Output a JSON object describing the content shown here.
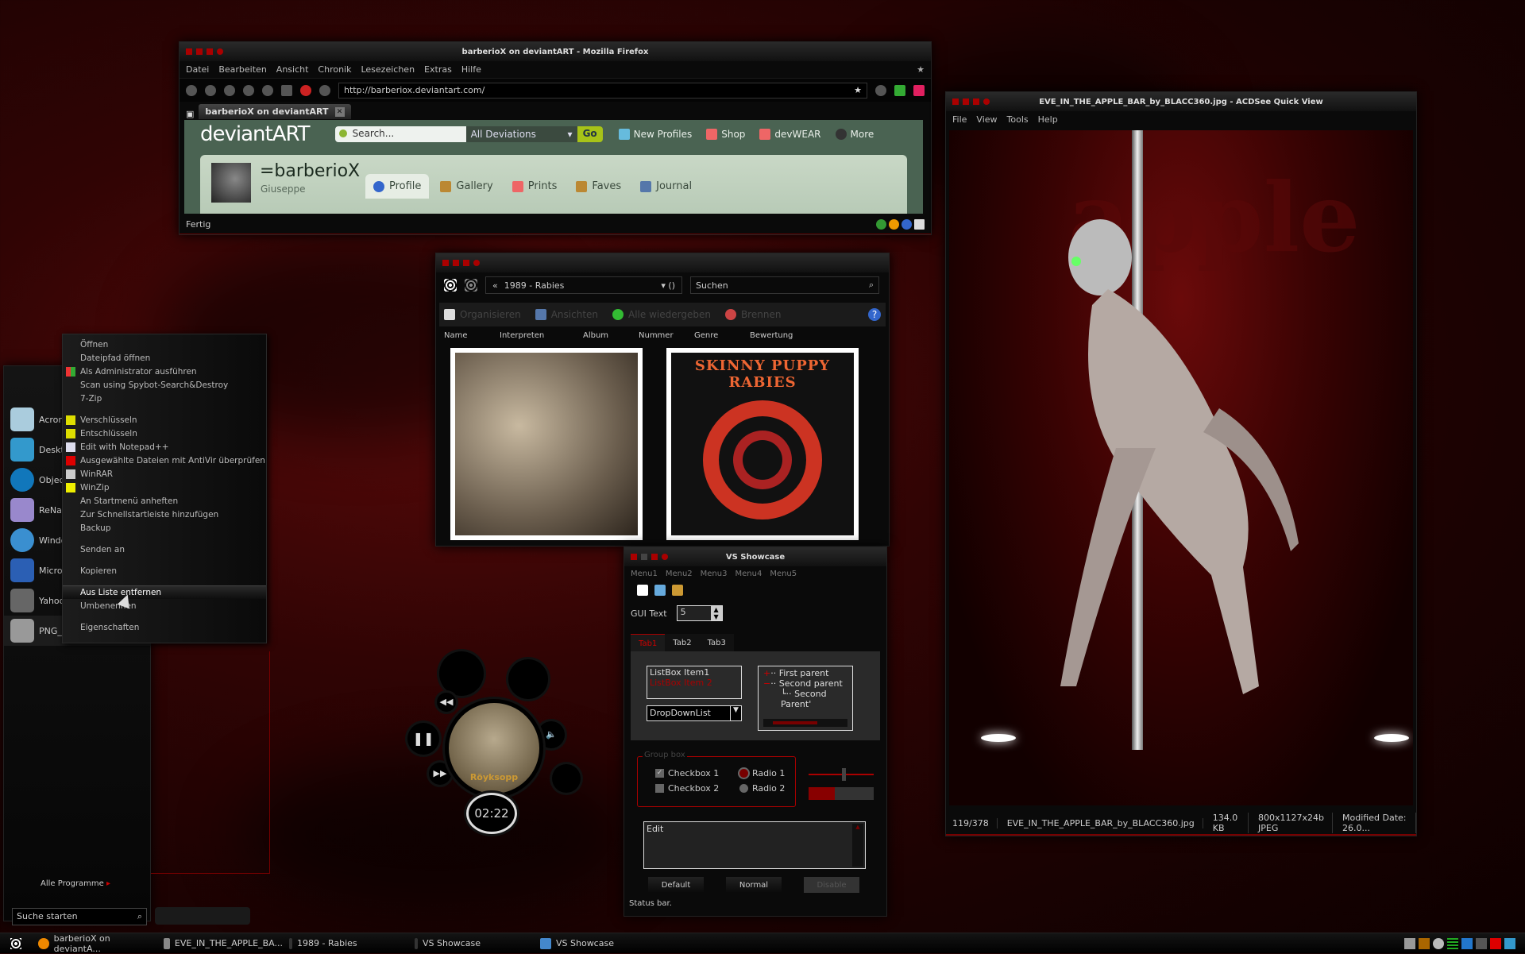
{
  "firefox": {
    "title": "barberioX on deviantART - Mozilla Firefox",
    "menu": [
      "Datei",
      "Bearbeiten",
      "Ansicht",
      "Chronik",
      "Lesezeichen",
      "Extras",
      "Hilfe"
    ],
    "url": "http://barberiox.deviantart.com/",
    "tab_label": "barberioX on deviantART",
    "status": "Fertig",
    "page": {
      "logo": "deviantART",
      "search_placeholder": "Search...",
      "search_scope": "All Deviations",
      "go_label": "Go",
      "nav": [
        "New Profiles",
        "Shop",
        "devWEAR",
        "More"
      ],
      "username": "=barberioX",
      "realname": "Giuseppe",
      "profile_tabs": [
        "Profile",
        "Gallery",
        "Prints",
        "Faves",
        "Journal"
      ],
      "active_tab": "Profile"
    }
  },
  "acdsee": {
    "title": "EVE_IN_THE_APPLE_BAR_by_BLACC360.jpg - ACDSee Quick View",
    "menu": [
      "File",
      "View",
      "Tools",
      "Help"
    ],
    "image_text": "apple",
    "status": {
      "index": "119/378",
      "filename": "EVE_IN_THE_APPLE_BAR_by_BLACC360.jpg",
      "size": "134.0 KB",
      "dimensions": "800x1127x24b JPEG",
      "modified": "Modified Date: 26.0..."
    }
  },
  "media_library": {
    "breadcrumb": "1989 - Rabies",
    "search_placeholder": "Suchen",
    "commands": [
      "Organisieren",
      "Ansichten",
      "Alle wiedergeben",
      "Brennen"
    ],
    "columns": [
      "Name",
      "Interpreten",
      "Album",
      "Nummer",
      "Genre",
      "Bewertung"
    ],
    "album_title_text": "SKINNY PUPPY RABIES"
  },
  "vs_showcase": {
    "title": "VS Showcase",
    "menu": [
      "Menu1",
      "Menu2",
      "Menu3",
      "Menu4",
      "Menu5"
    ],
    "gui_text_label": "GUI Text",
    "spinner_value": "5",
    "tabs": [
      "Tab1",
      "Tab2",
      "Tab3"
    ],
    "active_tab": "Tab1",
    "listbox": [
      "ListBox Item1",
      "ListBox Item 2"
    ],
    "dropdown_value": "DropDownList",
    "tree": [
      "First parent",
      "Second parent",
      "Second Parent'"
    ],
    "groupbox_label": "Group box",
    "checkboxes": [
      {
        "label": "Checkbox 1",
        "checked": true
      },
      {
        "label": "Checkbox 2",
        "checked": false
      }
    ],
    "radios": [
      {
        "label": "Radio 1",
        "selected": true
      },
      {
        "label": "Radio 2",
        "selected": false
      }
    ],
    "slider_value_pct": 55,
    "progress_pct": 40,
    "edit_text": "Edit",
    "buttons": [
      "Default",
      "Normal",
      "Disable"
    ],
    "status": "Status bar."
  },
  "start_menu": {
    "programs": [
      "Acronis",
      "Desktop",
      "Object",
      "ReName",
      "Windows",
      "Microsoft",
      "Yahoo!",
      "PNG_SHOT"
    ],
    "all_programs": "Alle Programme",
    "search_placeholder": "Suche starten"
  },
  "context_menu": {
    "items": [
      "Öffnen",
      "Dateipfad öffnen",
      "Als Administrator ausführen",
      "Scan using Spybot-Search&Destroy",
      "7-Zip",
      "Verschlüsseln",
      "Entschlüsseln",
      "Edit with Notepad++",
      "Ausgewählte Dateien mit AntiVir überprüfen",
      "WinRAR",
      "WinZip",
      "An Startmenü anheften",
      "Zur Schnellstartleiste hinzufügen",
      "Backup",
      "Senden an",
      "Kopieren",
      "Aus Liste entfernen",
      "Umbenennen",
      "Eigenschaften"
    ],
    "highlighted": "Aus Liste entfernen"
  },
  "player": {
    "time": "02:22",
    "album_text": "Röyksopp"
  },
  "taskbar": {
    "items": [
      "barberioX on deviantA...",
      "EVE_IN_THE_APPLE_BA...",
      "1989 - Rabies",
      "VS Showcase",
      "VS Showcase"
    ]
  }
}
